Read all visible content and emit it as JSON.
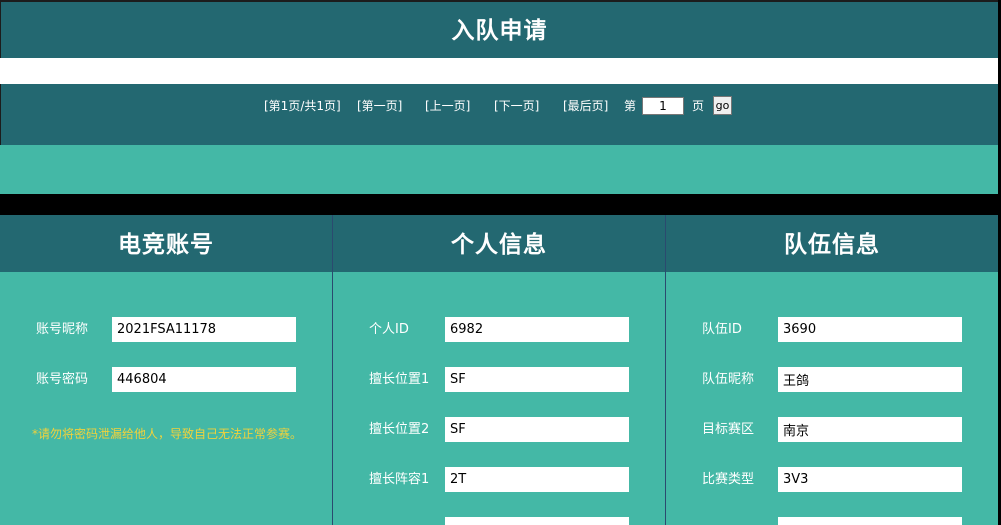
{
  "header": {
    "title": "入队申请"
  },
  "pager": {
    "info": "[第1页/共1页]",
    "first": "[第一页]",
    "prev": "[上一页]",
    "next": "[下一页]",
    "last": "[最后页]",
    "page_prefix": "第",
    "page_value": "1",
    "page_suffix": "页",
    "go_label": "go"
  },
  "columns": {
    "account": {
      "title": "电竞账号",
      "fields": [
        {
          "label": "账号昵称",
          "value": "2021FSA11178"
        },
        {
          "label": "账号密码",
          "value": "446804"
        }
      ],
      "warning": "*请勿将密码泄漏给他人，导致自己无法正常参赛。"
    },
    "personal": {
      "title": "个人信息",
      "fields": [
        {
          "label": "个人ID",
          "value": "6982"
        },
        {
          "label": "擅长位置1",
          "value": "SF"
        },
        {
          "label": "擅长位置2",
          "value": "SF"
        },
        {
          "label": "擅长阵容1",
          "value": "2T"
        }
      ]
    },
    "team": {
      "title": "队伍信息",
      "fields": [
        {
          "label": "队伍ID",
          "value": "3690"
        },
        {
          "label": "队伍昵称",
          "value": "王鸽"
        },
        {
          "label": "目标赛区",
          "value": "南京"
        },
        {
          "label": "比赛类型",
          "value": "3V3"
        }
      ]
    }
  },
  "colors": {
    "header_bg": "#236871",
    "panel_bg": "#44b8a6",
    "warning_text": "#f0d23c"
  }
}
